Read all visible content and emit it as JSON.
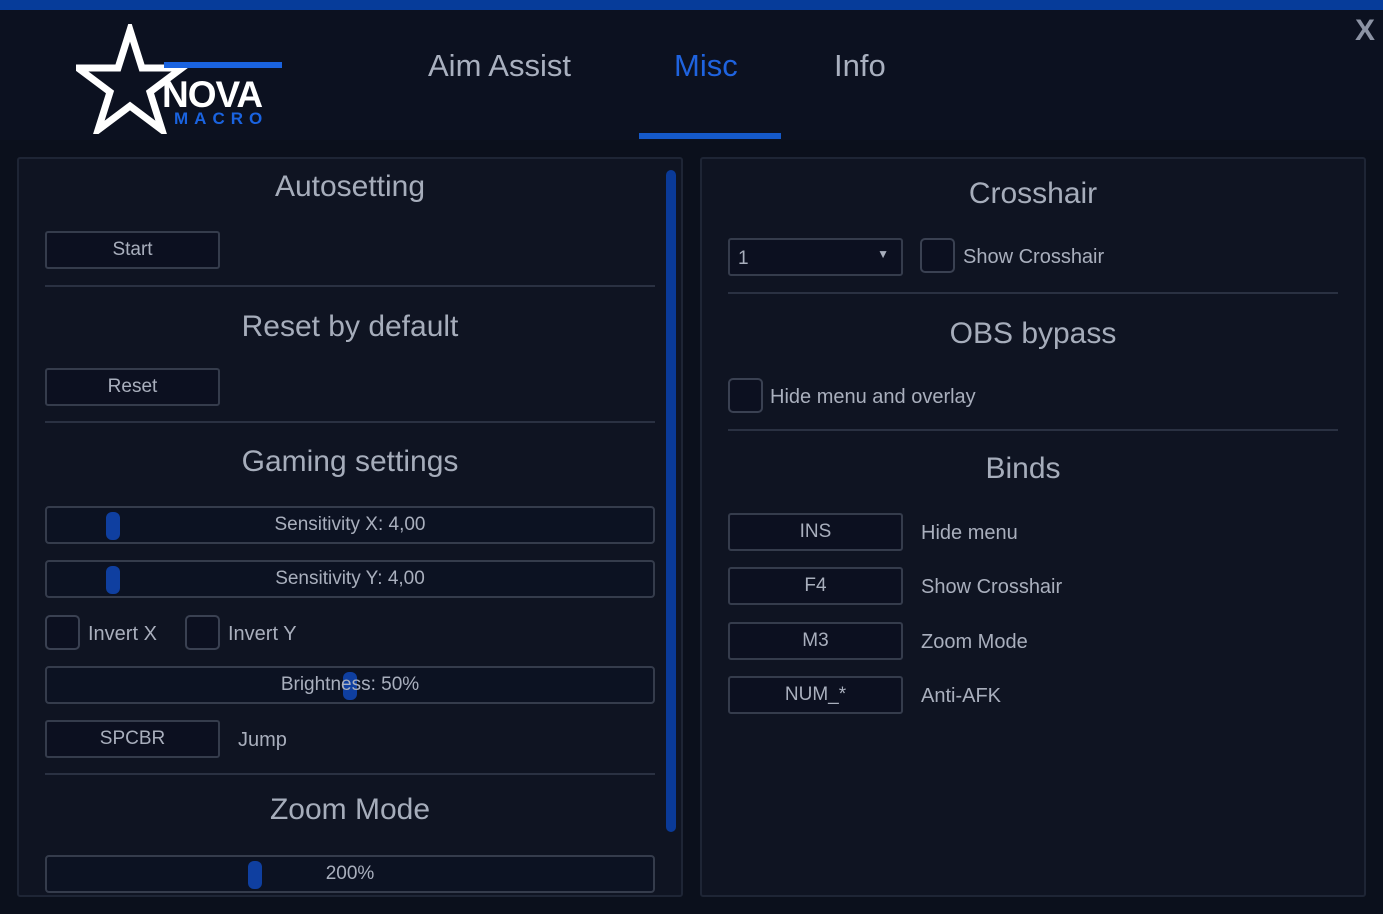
{
  "window": {
    "close_label": "X"
  },
  "logo": {
    "word": "NOVA",
    "sub": "MACRO"
  },
  "tabs": [
    {
      "label": "Aim Assist",
      "active": false
    },
    {
      "label": "Misc",
      "active": true
    },
    {
      "label": "Info",
      "active": false
    }
  ],
  "left": {
    "autosetting": {
      "title": "Autosetting",
      "start_label": "Start"
    },
    "reset": {
      "title": "Reset by default",
      "reset_label": "Reset"
    },
    "gaming": {
      "title": "Gaming settings",
      "sens_x": {
        "label": "Sensitivity X: 4,00",
        "fraction": 0.1
      },
      "sens_y": {
        "label": "Sensitivity Y: 4,00",
        "fraction": 0.1
      },
      "invert_x": {
        "label": "Invert X",
        "checked": false
      },
      "invert_y": {
        "label": "Invert Y",
        "checked": false
      },
      "brightness": {
        "label": "Brightness: 50%",
        "fraction": 0.5
      },
      "jump_key": "SPCBR",
      "jump_label": "Jump"
    },
    "zoom": {
      "title": "Zoom Mode",
      "label": "200%",
      "fraction": 0.34
    }
  },
  "right": {
    "crosshair": {
      "title": "Crosshair",
      "select_value": "1",
      "show_label": "Show Crosshair",
      "show_checked": false
    },
    "obs": {
      "title": "OBS bypass",
      "hide_label": "Hide menu and overlay",
      "hide_checked": false
    },
    "binds": {
      "title": "Binds",
      "items": [
        {
          "key": "INS",
          "action": "Hide menu"
        },
        {
          "key": "F4",
          "action": "Show Crosshair"
        },
        {
          "key": "M3",
          "action": "Zoom Mode"
        },
        {
          "key": "NUM_*",
          "action": "Anti-AFK"
        }
      ]
    }
  },
  "colors": {
    "accent": "#1f63df",
    "background": "#0b101c",
    "panel": "#0f1422"
  }
}
